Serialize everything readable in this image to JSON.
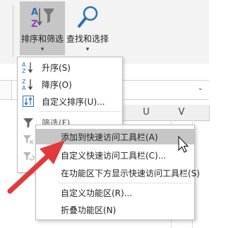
{
  "ribbon": {
    "sort_filter_label": "排序和筛选",
    "find_select_label": "查找和选择"
  },
  "sort_menu": {
    "items": [
      {
        "label": "升序(S)",
        "icon": "sort-ascending-icon"
      },
      {
        "label": "降序(O)",
        "icon": "sort-descending-icon"
      },
      {
        "label": "自定义排序(U)...",
        "icon": "custom-sort-icon"
      },
      {
        "label": "筛选(F)",
        "icon": "filter-icon"
      }
    ]
  },
  "grid": {
    "column_headers": [
      "U",
      "V"
    ]
  },
  "context_menu": {
    "items": [
      {
        "label": "添加到快速访问工具栏(A)",
        "highlighted": true
      },
      {
        "label": "自定义快速访问工具栏(C)..."
      },
      {
        "label": "在功能区下方显示快速访问工具栏(S)"
      },
      {
        "label": "自定义功能区(R)..."
      },
      {
        "label": "折叠功能区(N)"
      }
    ]
  },
  "colors": {
    "accent_blue": "#2b6fb8",
    "arrow_red": "#e03a3a",
    "highlight_gray": "#c6c6c6"
  }
}
